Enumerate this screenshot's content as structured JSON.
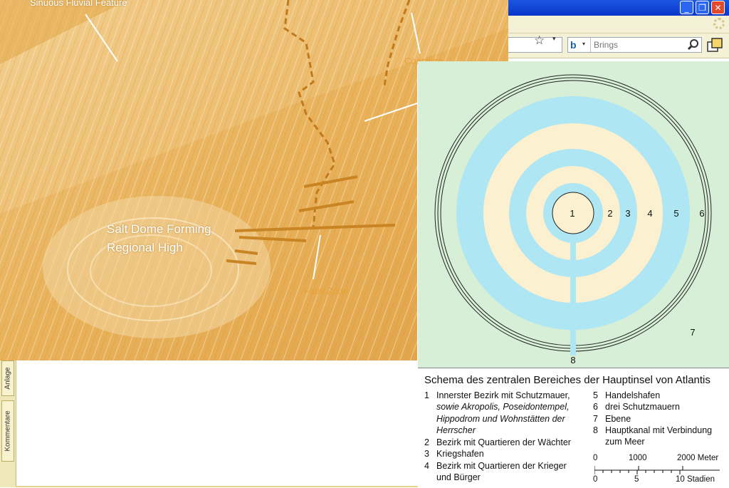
{
  "browser": {
    "search_placeholder": "Brings",
    "window_buttons": {
      "minimize": "_",
      "maximize": "❐",
      "close": "✕"
    }
  },
  "seismic_image": {
    "labels": {
      "sinuous": "Sinuous Fluvial Feature",
      "salt_line1": "Salt Dome Forming",
      "salt_line2": "Regional High",
      "fault": "Fault Zone",
      "coastline": "Coastline"
    }
  },
  "side_tabs": {
    "anlage": "Anlage",
    "kommentare": "Kommentare"
  },
  "atlantis": {
    "ring_numbers": [
      "1",
      "2",
      "3",
      "4",
      "5",
      "6",
      "7",
      "8"
    ],
    "caption_title": "Schema des zentralen Bereiches der Hauptinsel von Atlantis",
    "legend_left": [
      {
        "num": "1",
        "line1": "Innerster Bezirk mit Schutzmauer,",
        "line2": "sowie Akropolis, Poseidontempel,",
        "line3": "Hippodrom und Wohnstätten der",
        "line4": "Herrscher"
      },
      {
        "num": "2",
        "text": "Bezirk mit Quartieren der Wächter"
      },
      {
        "num": "3",
        "text": "Kriegshafen"
      },
      {
        "num": "4",
        "line1": "Bezirk mit Quartieren der Krieger",
        "line2": "und Bürger"
      }
    ],
    "legend_right": [
      {
        "num": "5",
        "text": "Handelshafen"
      },
      {
        "num": "6",
        "text": "drei Schutzmauern"
      },
      {
        "num": "7",
        "text": "Ebene"
      },
      {
        "num": "8",
        "line1": "Hauptkanal mit Verbindung",
        "line2": "zum Meer"
      }
    ],
    "scale_top": [
      "0",
      "1000",
      "2000 Meter"
    ],
    "scale_bottom": [
      "0",
      "5",
      "10 Stadien"
    ]
  },
  "colors": {
    "titlebar": "#0a36c8",
    "toolbar": "#f4f1d6",
    "seismic": "#e6a33a",
    "water": "#aee6f4",
    "land_ring": "#fbf0cf",
    "plain": "#d6efd6"
  }
}
